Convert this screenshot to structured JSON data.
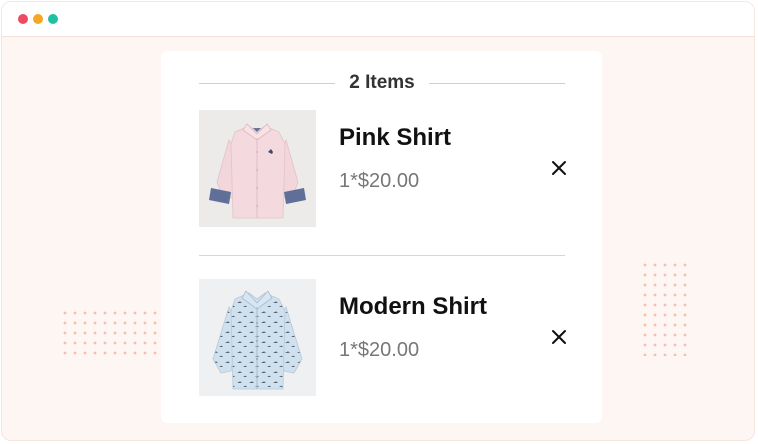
{
  "window": {
    "controls": [
      {
        "name": "close",
        "color": "#ee4a62"
      },
      {
        "name": "minimize",
        "color": "#f5a623"
      },
      {
        "name": "maximize",
        "color": "#20c0a3"
      }
    ]
  },
  "cart": {
    "item_count_label": "2 Items",
    "items": [
      {
        "name": "Pink Shirt",
        "price": "1*$20.00",
        "image_icon": "pink-shirt-icon",
        "remove_icon": "close-icon"
      },
      {
        "name": "Modern Shirt",
        "price": "1*$20.00",
        "image_icon": "blue-patterned-shirt-icon",
        "remove_icon": "close-icon"
      }
    ]
  },
  "colors": {
    "page_background": "#fdf6f3",
    "card_background": "#ffffff",
    "decor_dots": "#f3b9a8",
    "price_text": "#777777"
  }
}
